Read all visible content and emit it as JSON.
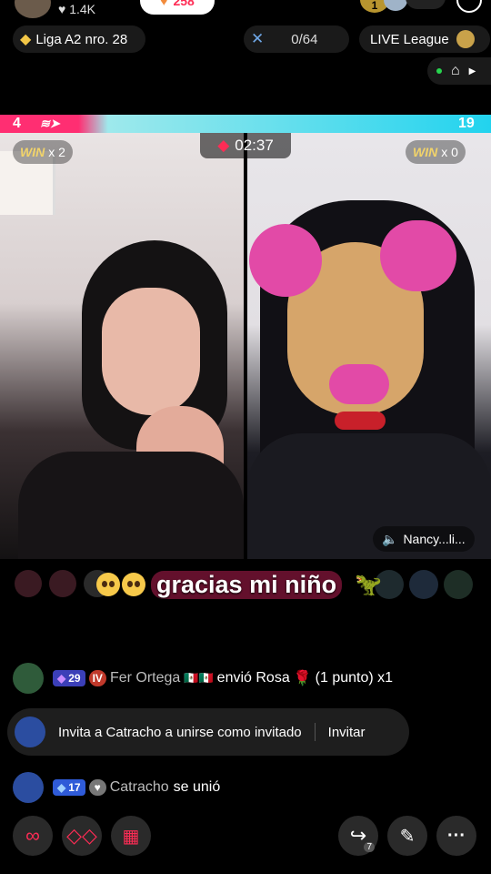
{
  "top": {
    "likes": "1.4K",
    "coins": "258",
    "rank_badge": "1",
    "league_label": "Liga A2 nro. 28",
    "score_progress": "0/64",
    "live_league": "LIVE League"
  },
  "battle": {
    "left_score": "4",
    "right_score": "19",
    "timer": "02:37",
    "left_win_label": "WIN",
    "left_win_count": "x 2",
    "right_win_label": "WIN",
    "right_win_count": "x 0",
    "right_host_name": "Nancy...li..."
  },
  "overlay_comment": "gracias mi niño",
  "chat": [
    {
      "level": "29",
      "tag": "IV",
      "user": "Fer Ortega",
      "message": "envió Rosa",
      "detail": "(1 punto) x1"
    },
    {
      "invite_text": "Invita a Catracho a unirse como invitado",
      "invite_button": "Invitar"
    },
    {
      "level": "17",
      "user": "Catracho",
      "message": "se unió"
    }
  ],
  "bottom": {
    "share_count": "7"
  },
  "colors": {
    "battle_left": "#ff2e72",
    "battle_right": "#22d3ee",
    "accent_pink": "#fe2c55"
  }
}
